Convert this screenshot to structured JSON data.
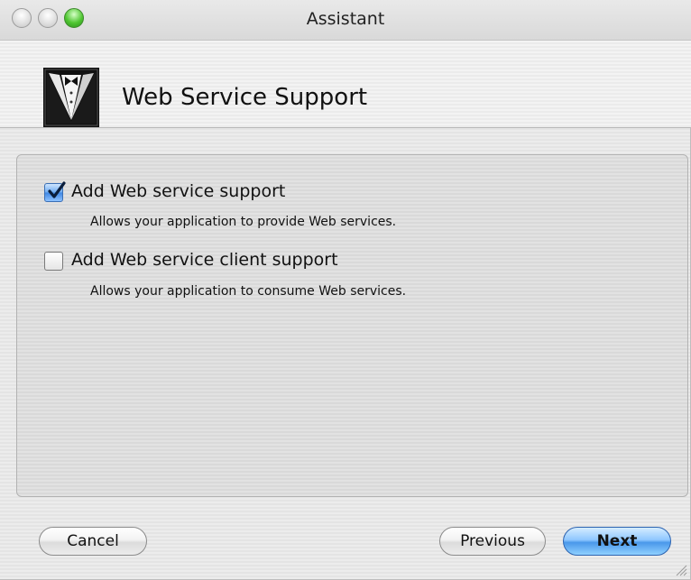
{
  "window": {
    "title": "Assistant"
  },
  "header": {
    "title": "Web Service Support",
    "logo_icon": "tuxedo-icon"
  },
  "options": [
    {
      "label": "Add Web service support",
      "description": "Allows your application to provide Web services.",
      "checked": true
    },
    {
      "label": "Add Web service client support",
      "description": "Allows your application to consume Web services.",
      "checked": false
    }
  ],
  "buttons": {
    "cancel": "Cancel",
    "previous": "Previous",
    "next": "Next"
  },
  "colors": {
    "accent": "#4a98ea",
    "zoom_button": "#4fc631"
  }
}
